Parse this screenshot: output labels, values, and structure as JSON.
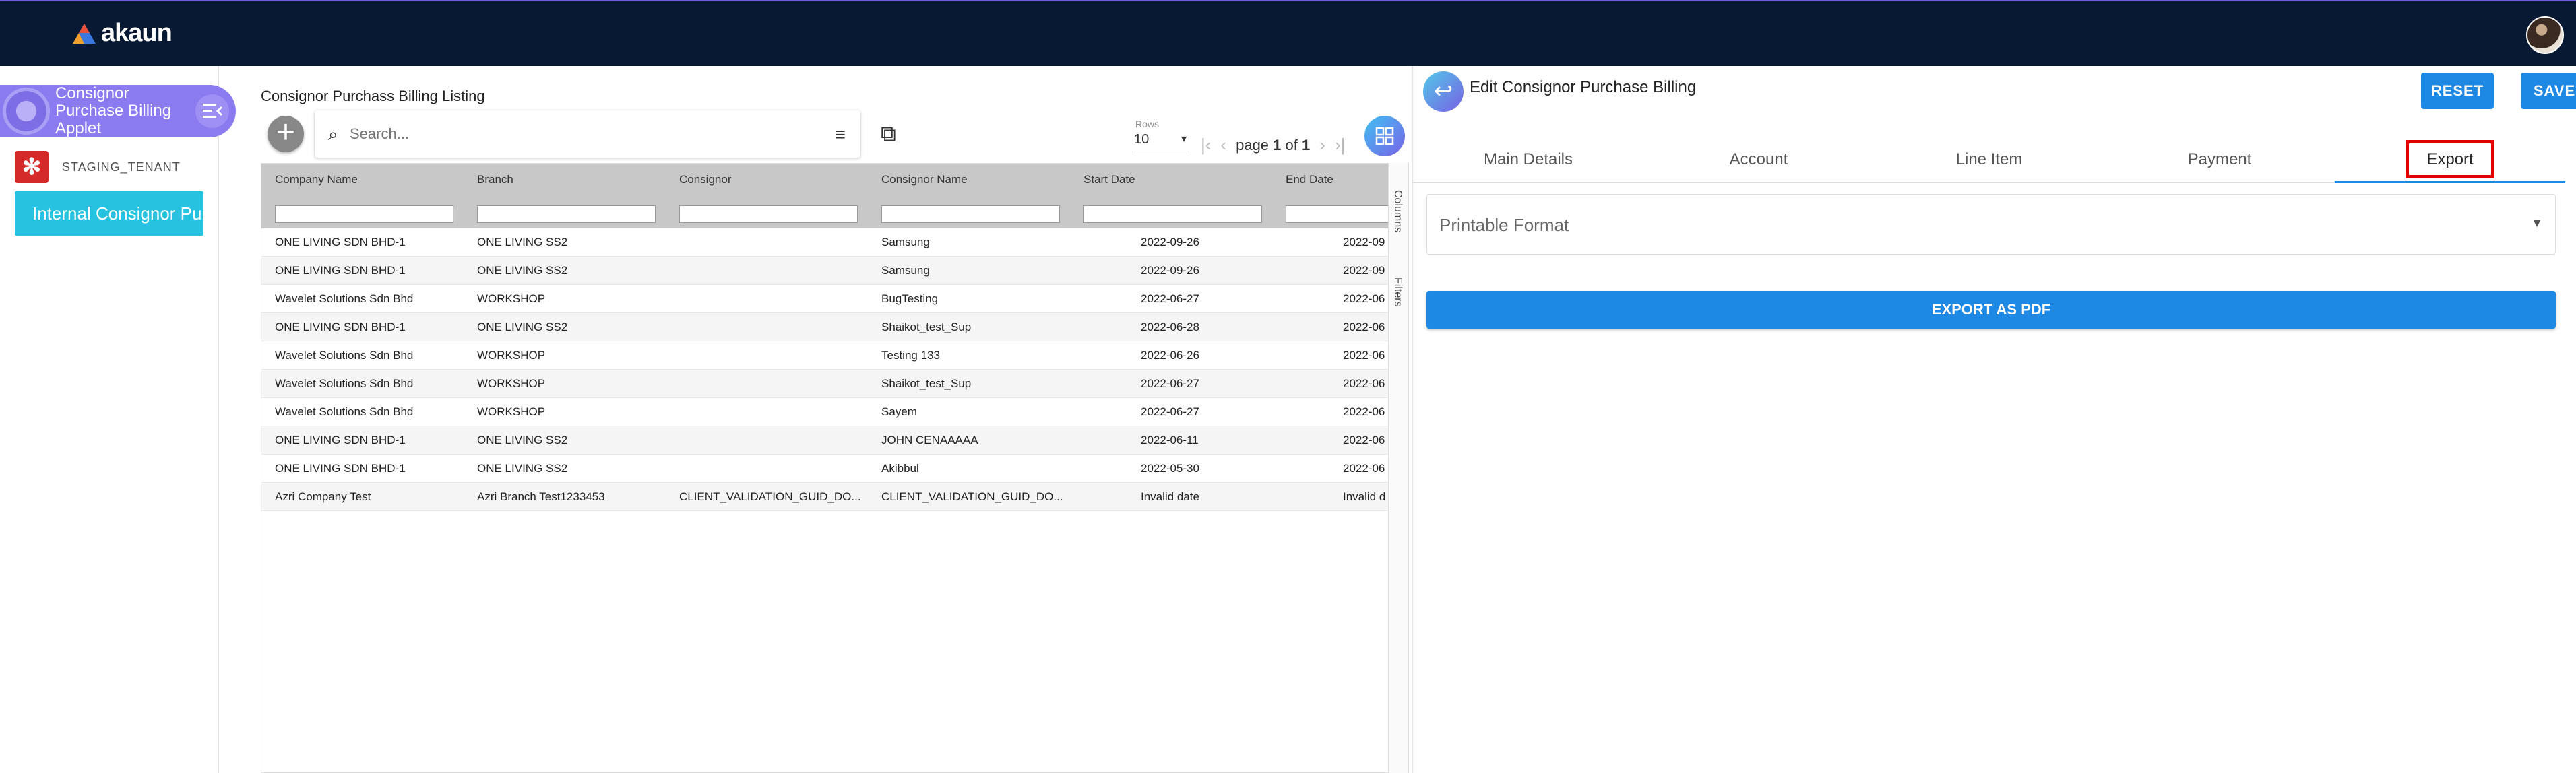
{
  "app": {
    "name": "akaun"
  },
  "applet": {
    "title": "Consignor Purchase Billing Applet"
  },
  "tenant": {
    "name": "STAGING_TENANT"
  },
  "nav": {
    "active_item": "Internal Consignor Purchase Billing"
  },
  "listing": {
    "title": "Consignor Purchass Billing Listing",
    "search_placeholder": "Search...",
    "rows_label": "Rows",
    "rows_value": "10",
    "pager": {
      "prefix": "page",
      "current": "1",
      "of": "of",
      "total": "1"
    },
    "side_tabs": {
      "columns": "Columns",
      "filters": "Filters"
    },
    "columns": [
      "Company Name",
      "Branch",
      "Consignor",
      "Consignor Name",
      "Start Date",
      "End Date"
    ],
    "rows": [
      [
        "ONE LIVING SDN BHD-1",
        "ONE LIVING SS2",
        "",
        "Samsung",
        "2022-09-26",
        "2022-09"
      ],
      [
        "ONE LIVING SDN BHD-1",
        "ONE LIVING SS2",
        "",
        "Samsung",
        "2022-09-26",
        "2022-09"
      ],
      [
        "Wavelet Solutions Sdn Bhd",
        "WORKSHOP",
        "",
        "BugTesting",
        "2022-06-27",
        "2022-06"
      ],
      [
        "ONE LIVING SDN BHD-1",
        "ONE LIVING SS2",
        "",
        "Shaikot_test_Sup",
        "2022-06-28",
        "2022-06"
      ],
      [
        "Wavelet Solutions Sdn Bhd",
        "WORKSHOP",
        "",
        "Testing 133",
        "2022-06-26",
        "2022-06"
      ],
      [
        "Wavelet Solutions Sdn Bhd",
        "WORKSHOP",
        "",
        "Shaikot_test_Sup",
        "2022-06-27",
        "2022-06"
      ],
      [
        "Wavelet Solutions Sdn Bhd",
        "WORKSHOP",
        "",
        "Sayem",
        "2022-06-27",
        "2022-06"
      ],
      [
        "ONE LIVING SDN BHD-1",
        "ONE LIVING SS2",
        "",
        "JOHN CENAAAAA",
        "2022-06-11",
        "2022-06"
      ],
      [
        "ONE LIVING SDN BHD-1",
        "ONE LIVING SS2",
        "",
        "Akibbul",
        "2022-05-30",
        "2022-06"
      ],
      [
        "Azri Company Test",
        "Azri Branch Test1233453",
        "CLIENT_VALIDATION_GUID_DO...",
        "CLIENT_VALIDATION_GUID_DO...",
        "Invalid date",
        "Invalid d"
      ]
    ]
  },
  "edit": {
    "title": "Edit Consignor Purchase Billing",
    "reset_label": "RESET",
    "save_label": "SAVE",
    "tabs": [
      "Main Details",
      "Account",
      "Line Item",
      "Payment",
      "Export"
    ],
    "active_tab": "Export",
    "printable_format_label": "Printable Format",
    "export_pdf_label": "EXPORT AS PDF"
  },
  "colors": {
    "topbar": "#081a33",
    "accent": "#1e88e5",
    "applet": "#8a7bf0",
    "nav_active": "#26c2e0",
    "highlight": "#e00000"
  }
}
